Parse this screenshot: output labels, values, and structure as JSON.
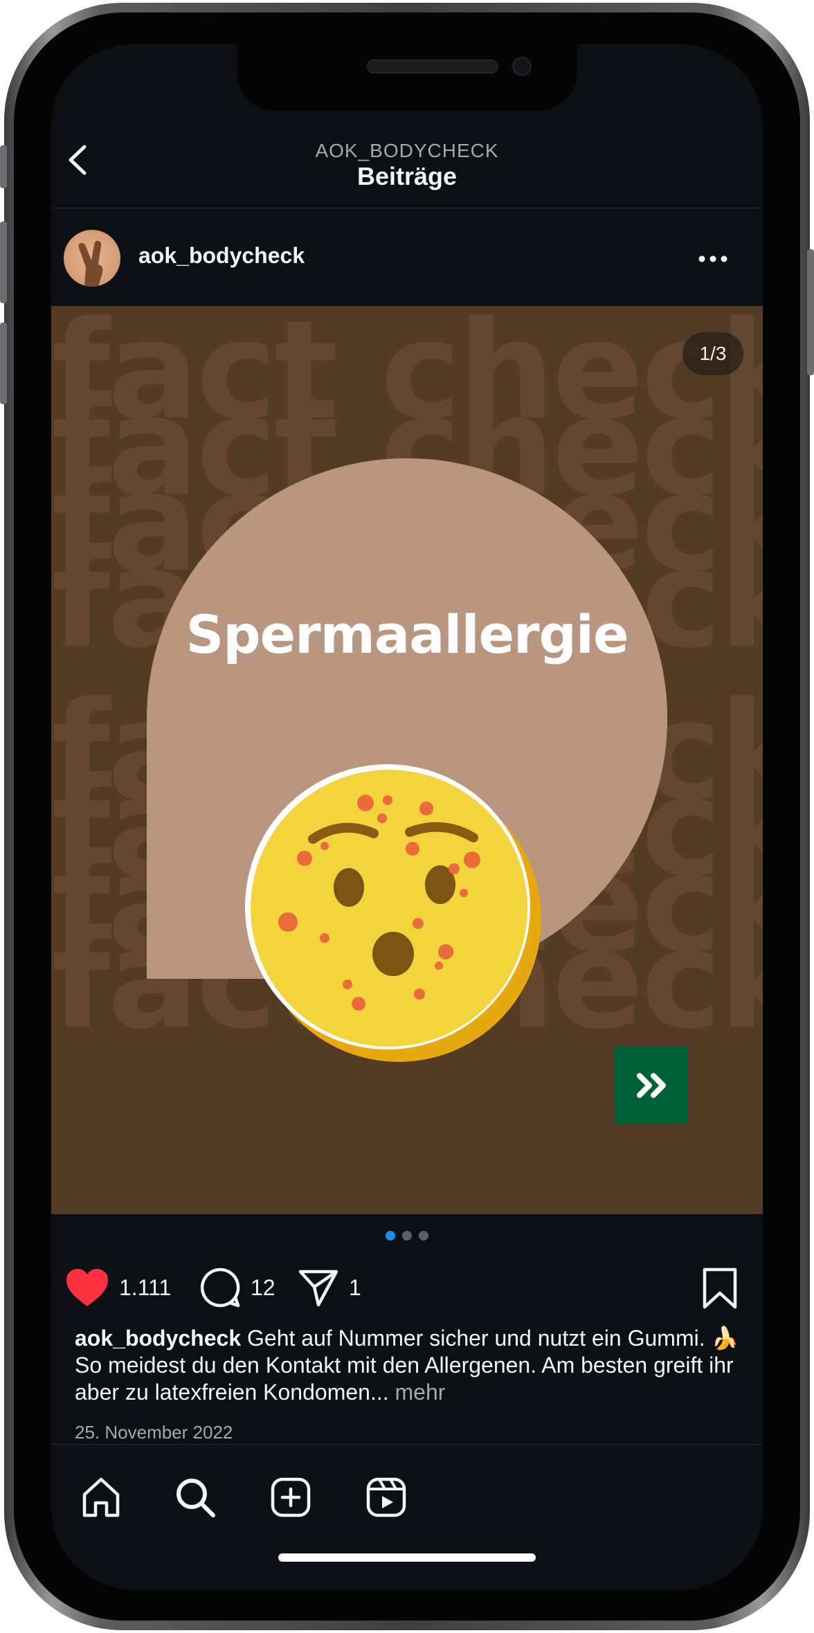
{
  "header": {
    "subtitle": "AOK_BODYCHECK",
    "title": "Beiträge",
    "back_icon": "chevron-left-icon"
  },
  "post": {
    "username": "aok_bodycheck",
    "counter": "1/3",
    "image_title": "Spermaallergie",
    "background_word": "fact check",
    "carousel": {
      "count": 3,
      "active_index": 0
    },
    "likes": "1.111",
    "comments": "12",
    "shares": "1",
    "caption_user": "aok_bodycheck",
    "caption_text": " Geht auf Nummer sicher und nutzt ein Gummi. 🍌 So meidest du den Kontakt mit den Allergenen. Am besten greift ihr aber zu latexfreien Kondomen...",
    "caption_more": " mehr",
    "date": "25. November 2022"
  },
  "colors": {
    "background": "#0c1014",
    "post_bg": "#543b26",
    "bubble": "#b89680",
    "emoji_yellow": "#f4d43c",
    "next_button": "#006139",
    "like_red": "#ff3040",
    "active_dot": "#1d8cf5"
  },
  "tabbar": {
    "items": [
      "home-icon",
      "search-icon",
      "create-icon",
      "reels-icon"
    ]
  }
}
